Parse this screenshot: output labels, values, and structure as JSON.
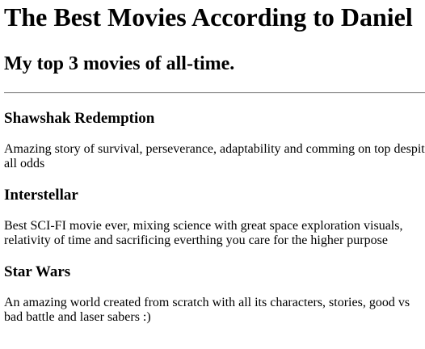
{
  "page": {
    "title": "The Best Movies According to Daniel",
    "subtitle": "My top 3 movies of all-time."
  },
  "movies": [
    {
      "title": "Shawshak Redemption",
      "description_line1": "Amazing story of survival, perseverance, adaptability and comming on top despit",
      "description_line2": "all odds"
    },
    {
      "title": "Interstellar",
      "description_line1": "Best SCI-FI movie ever, mixing science with great space exploration visuals,",
      "description_line2": "relativity of time and sacrificing everthing you care for the higher purpose"
    },
    {
      "title": "Star Wars",
      "description_line1": "An amazing world created from scratch with all its characters, stories, good vs",
      "description_line2": "bad battle and laser sabers :)"
    }
  ]
}
